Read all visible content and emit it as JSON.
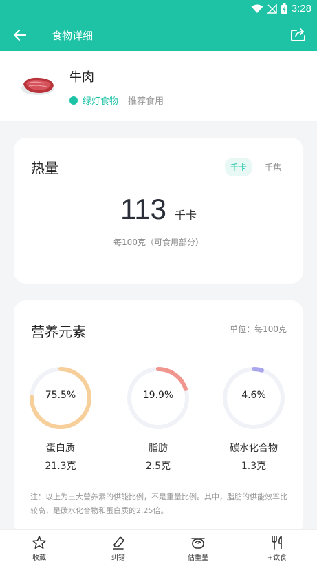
{
  "status_bar": {
    "time": "3:28",
    "icons": [
      "wifi-icon",
      "signal-off-icon",
      "battery-charging-icon"
    ]
  },
  "app_bar": {
    "title": "食物详细",
    "back_icon": "arrow-left-icon",
    "share_icon": "share-icon"
  },
  "food": {
    "name": "牛肉",
    "tag_label": "绿灯食物",
    "tag_color": "#1ec3a6",
    "advice": "推荐食用",
    "image_icon": "beef-image"
  },
  "energy": {
    "title": "热量",
    "units": [
      {
        "label": "千卡",
        "active": true
      },
      {
        "label": "千焦",
        "active": false
      }
    ],
    "value": "113",
    "unit": "千卡",
    "note": "每100克（可食用部分）"
  },
  "nutrients": {
    "title": "营养元素",
    "unit_note": "单位：每100克",
    "items": [
      {
        "name": "蛋白质",
        "percent_label": "75.5%",
        "percent": 75.5,
        "amount": "21.3克",
        "color": "#f7cf9a"
      },
      {
        "name": "脂肪",
        "percent_label": "19.9%",
        "percent": 19.9,
        "amount": "2.5克",
        "color": "#f1968e"
      },
      {
        "name": "碳水化合物",
        "percent_label": "4.6%",
        "percent": 4.6,
        "amount": "1.3克",
        "color": "#a9a6ee"
      }
    ],
    "note": "注：以上为三大营养素的供能比例，不是重量比例。其中，脂肪的供能效率比较高，是碳水化合物和蛋白质的2.25倍。"
  },
  "bottom_nav": [
    {
      "label": "收藏",
      "icon": "star-icon"
    },
    {
      "label": "纠错",
      "icon": "eraser-icon"
    },
    {
      "label": "估重量",
      "icon": "scale-icon"
    },
    {
      "label": "+饮食",
      "icon": "fork-knife-icon"
    }
  ],
  "colors": {
    "brand": "#1ec3a6",
    "ring_track": "#f1f2f7"
  }
}
